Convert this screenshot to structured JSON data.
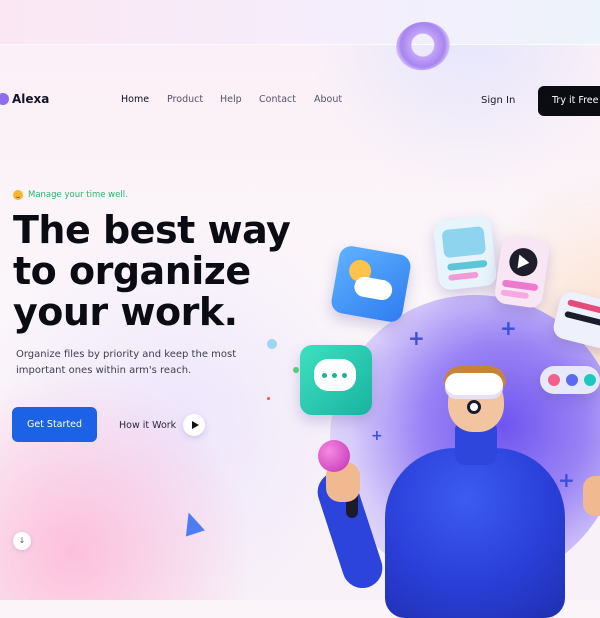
{
  "brand": {
    "name": "Alexa"
  },
  "nav": {
    "items": [
      {
        "label": "Home",
        "active": true
      },
      {
        "label": "Product",
        "active": false
      },
      {
        "label": "Help",
        "active": false
      },
      {
        "label": "Contact",
        "active": false
      },
      {
        "label": "About",
        "active": false
      }
    ]
  },
  "header": {
    "sign_in_label": "Sign In",
    "try_label": "Try it Free"
  },
  "hero": {
    "tagline": "Manage your time well.",
    "headline_lines": [
      "The best way",
      "to organize",
      "your work."
    ],
    "description_lines": [
      "Organize files by priority and keep the most",
      "important ones within arm's reach."
    ],
    "primary_cta": "Get Started",
    "secondary_cta": "How it Work"
  },
  "scroll": {
    "icon": "arrow-down-icon",
    "glyph": "↓"
  },
  "colors": {
    "primary": "#1c62e6",
    "dark_button": "#0b0b12",
    "tagline_green": "#2db36a",
    "brand_purple": "#8d6cf0"
  },
  "icons": [
    "play-icon",
    "smile-icon",
    "weather-icon",
    "chat-icon",
    "image-icon",
    "video-icon"
  ]
}
